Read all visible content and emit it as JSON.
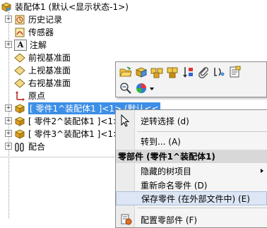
{
  "tree": {
    "root_label": "装配体1 (默认<显示状态-1>)",
    "items": [
      {
        "label": "历史记录",
        "icon": "history-icon"
      },
      {
        "label": "传感器",
        "icon": "sensor-icon"
      },
      {
        "label": "注解",
        "icon": "annotation-icon",
        "icon_glyph": "A"
      },
      {
        "label": "前视基准面",
        "icon": "plane-icon"
      },
      {
        "label": "上视基准面",
        "icon": "plane-icon"
      },
      {
        "label": "右视基准面",
        "icon": "plane-icon"
      },
      {
        "label": "原点",
        "icon": "origin-icon"
      },
      {
        "label": "[ 零件1^装配体1 ]<1> (默认<<",
        "icon": "part-icon",
        "selected": true
      },
      {
        "label": "[ 零件2^装配体1 ]<1>",
        "icon": "part-icon"
      },
      {
        "label": "[ 零件3^装配体1 ]<1>",
        "icon": "part-icon"
      },
      {
        "label": "配合",
        "icon": "mates-icon"
      }
    ]
  },
  "toolbar": {
    "icons": [
      "open-part-icon",
      "edit-component-icon",
      "hide-components-icon",
      "change-transparency-icon",
      "isolate-icon",
      "paperclip-icon",
      "smart-mates-icon",
      "component-properties-icon",
      "zoom-to-selection-icon",
      "appearance-icon",
      "dropdown-arrow-icon"
    ]
  },
  "menu": {
    "items": [
      {
        "label": "逆转选择 (d)"
      },
      {
        "label": "转到... (A)"
      },
      {
        "label": "隐藏的树项目"
      },
      {
        "label": "重新命名零件 (D)"
      },
      {
        "label": "保存零件 (在外部文件中) (E)"
      },
      {
        "label": "配置零部件 (F)"
      }
    ],
    "section_header": "零部件 (零件1^装配体1)"
  },
  "colors": {
    "selection": "#3d8ee6",
    "menu_highlight": "#dce6f4",
    "menu_header": "#d8d8d8"
  }
}
